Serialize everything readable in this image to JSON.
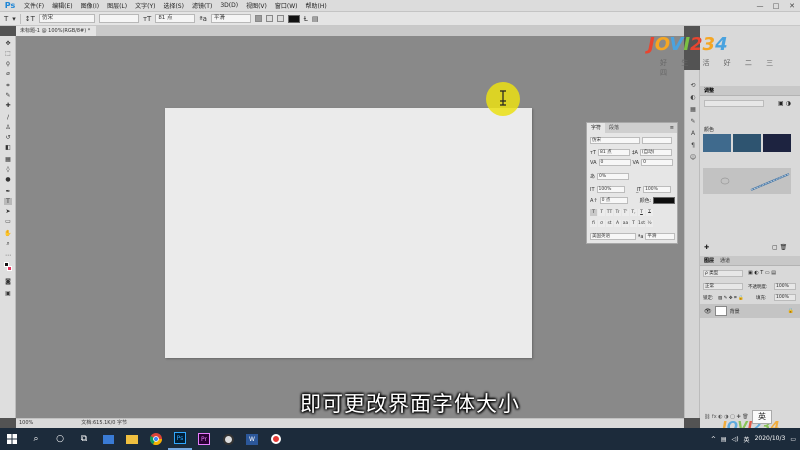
{
  "app": {
    "logo": "Ps",
    "menu": [
      "文件(F)",
      "编辑(E)",
      "图像(I)",
      "图层(L)",
      "文字(Y)",
      "选择(S)",
      "滤镜(T)",
      "3D(D)",
      "视图(V)",
      "窗口(W)",
      "帮助(H)"
    ],
    "window_controls": [
      "—",
      "□",
      "✕"
    ]
  },
  "options_bar": {
    "tool_glyph": "T",
    "font_family": "仿宋",
    "font_style": "",
    "font_size": "81 点",
    "antialias": "平滑",
    "text_color": "#111111"
  },
  "document": {
    "tab_label": "未标题-1 @ 100%(RGB/8#) *",
    "tab_close": "×",
    "status_zoom": "100%",
    "status_info": "文档:615.1K/0 字节"
  },
  "subtitle": "即可更改界面字体大小",
  "character_panel": {
    "tabs": [
      "字符",
      "段落"
    ],
    "font_family": "仿宋",
    "font_size": "81 点",
    "leading": "(自动)",
    "kerning": "0",
    "tracking": "0",
    "scale_pct": "0%",
    "vscale": "100%",
    "hscale": "100%",
    "baseline": "0 点",
    "color_label": "颜色:",
    "style_buttons": [
      "T",
      "T",
      "TT",
      "Tr",
      "T'",
      "T,",
      "T",
      "T"
    ],
    "opentype_buttons": [
      "fi",
      "σ",
      "st",
      "A",
      "aa",
      "T",
      "1st",
      "½"
    ],
    "language": "美国英语",
    "antialias": "平滑",
    "menu_glyph": "≡"
  },
  "right_panel": {
    "top_tabs": [
      "调整"
    ],
    "swatches_label": "颜色",
    "swatch_colors": [
      "#3f6a8d",
      "#2e5470",
      "#1d2340"
    ],
    "layers_tabs": [
      "图层",
      "通道"
    ],
    "layer_kind": "ρ 类型",
    "blend_mode": "正常",
    "opacity_label": "不透明度:",
    "opacity": "100%",
    "fill_label": "填充:",
    "fill": "100%",
    "lock_label": "锁定:",
    "layers": [
      {
        "name": "背景",
        "visible": true,
        "locked": true
      }
    ]
  },
  "watermark": {
    "brand": "JOVI234",
    "tagline": "好 生 活 好 二 三 四",
    "colors": [
      "#e8452f",
      "#f5a623",
      "#4aa3df",
      "#7bc043"
    ]
  },
  "taskbar": {
    "ime": "英",
    "date": "2020/10/3",
    "tray_lang": "英",
    "apps": [
      "start",
      "search",
      "task-view",
      "store",
      "explorer",
      "chrome",
      "photoshop",
      "premiere",
      "obs",
      "word",
      "record"
    ]
  }
}
